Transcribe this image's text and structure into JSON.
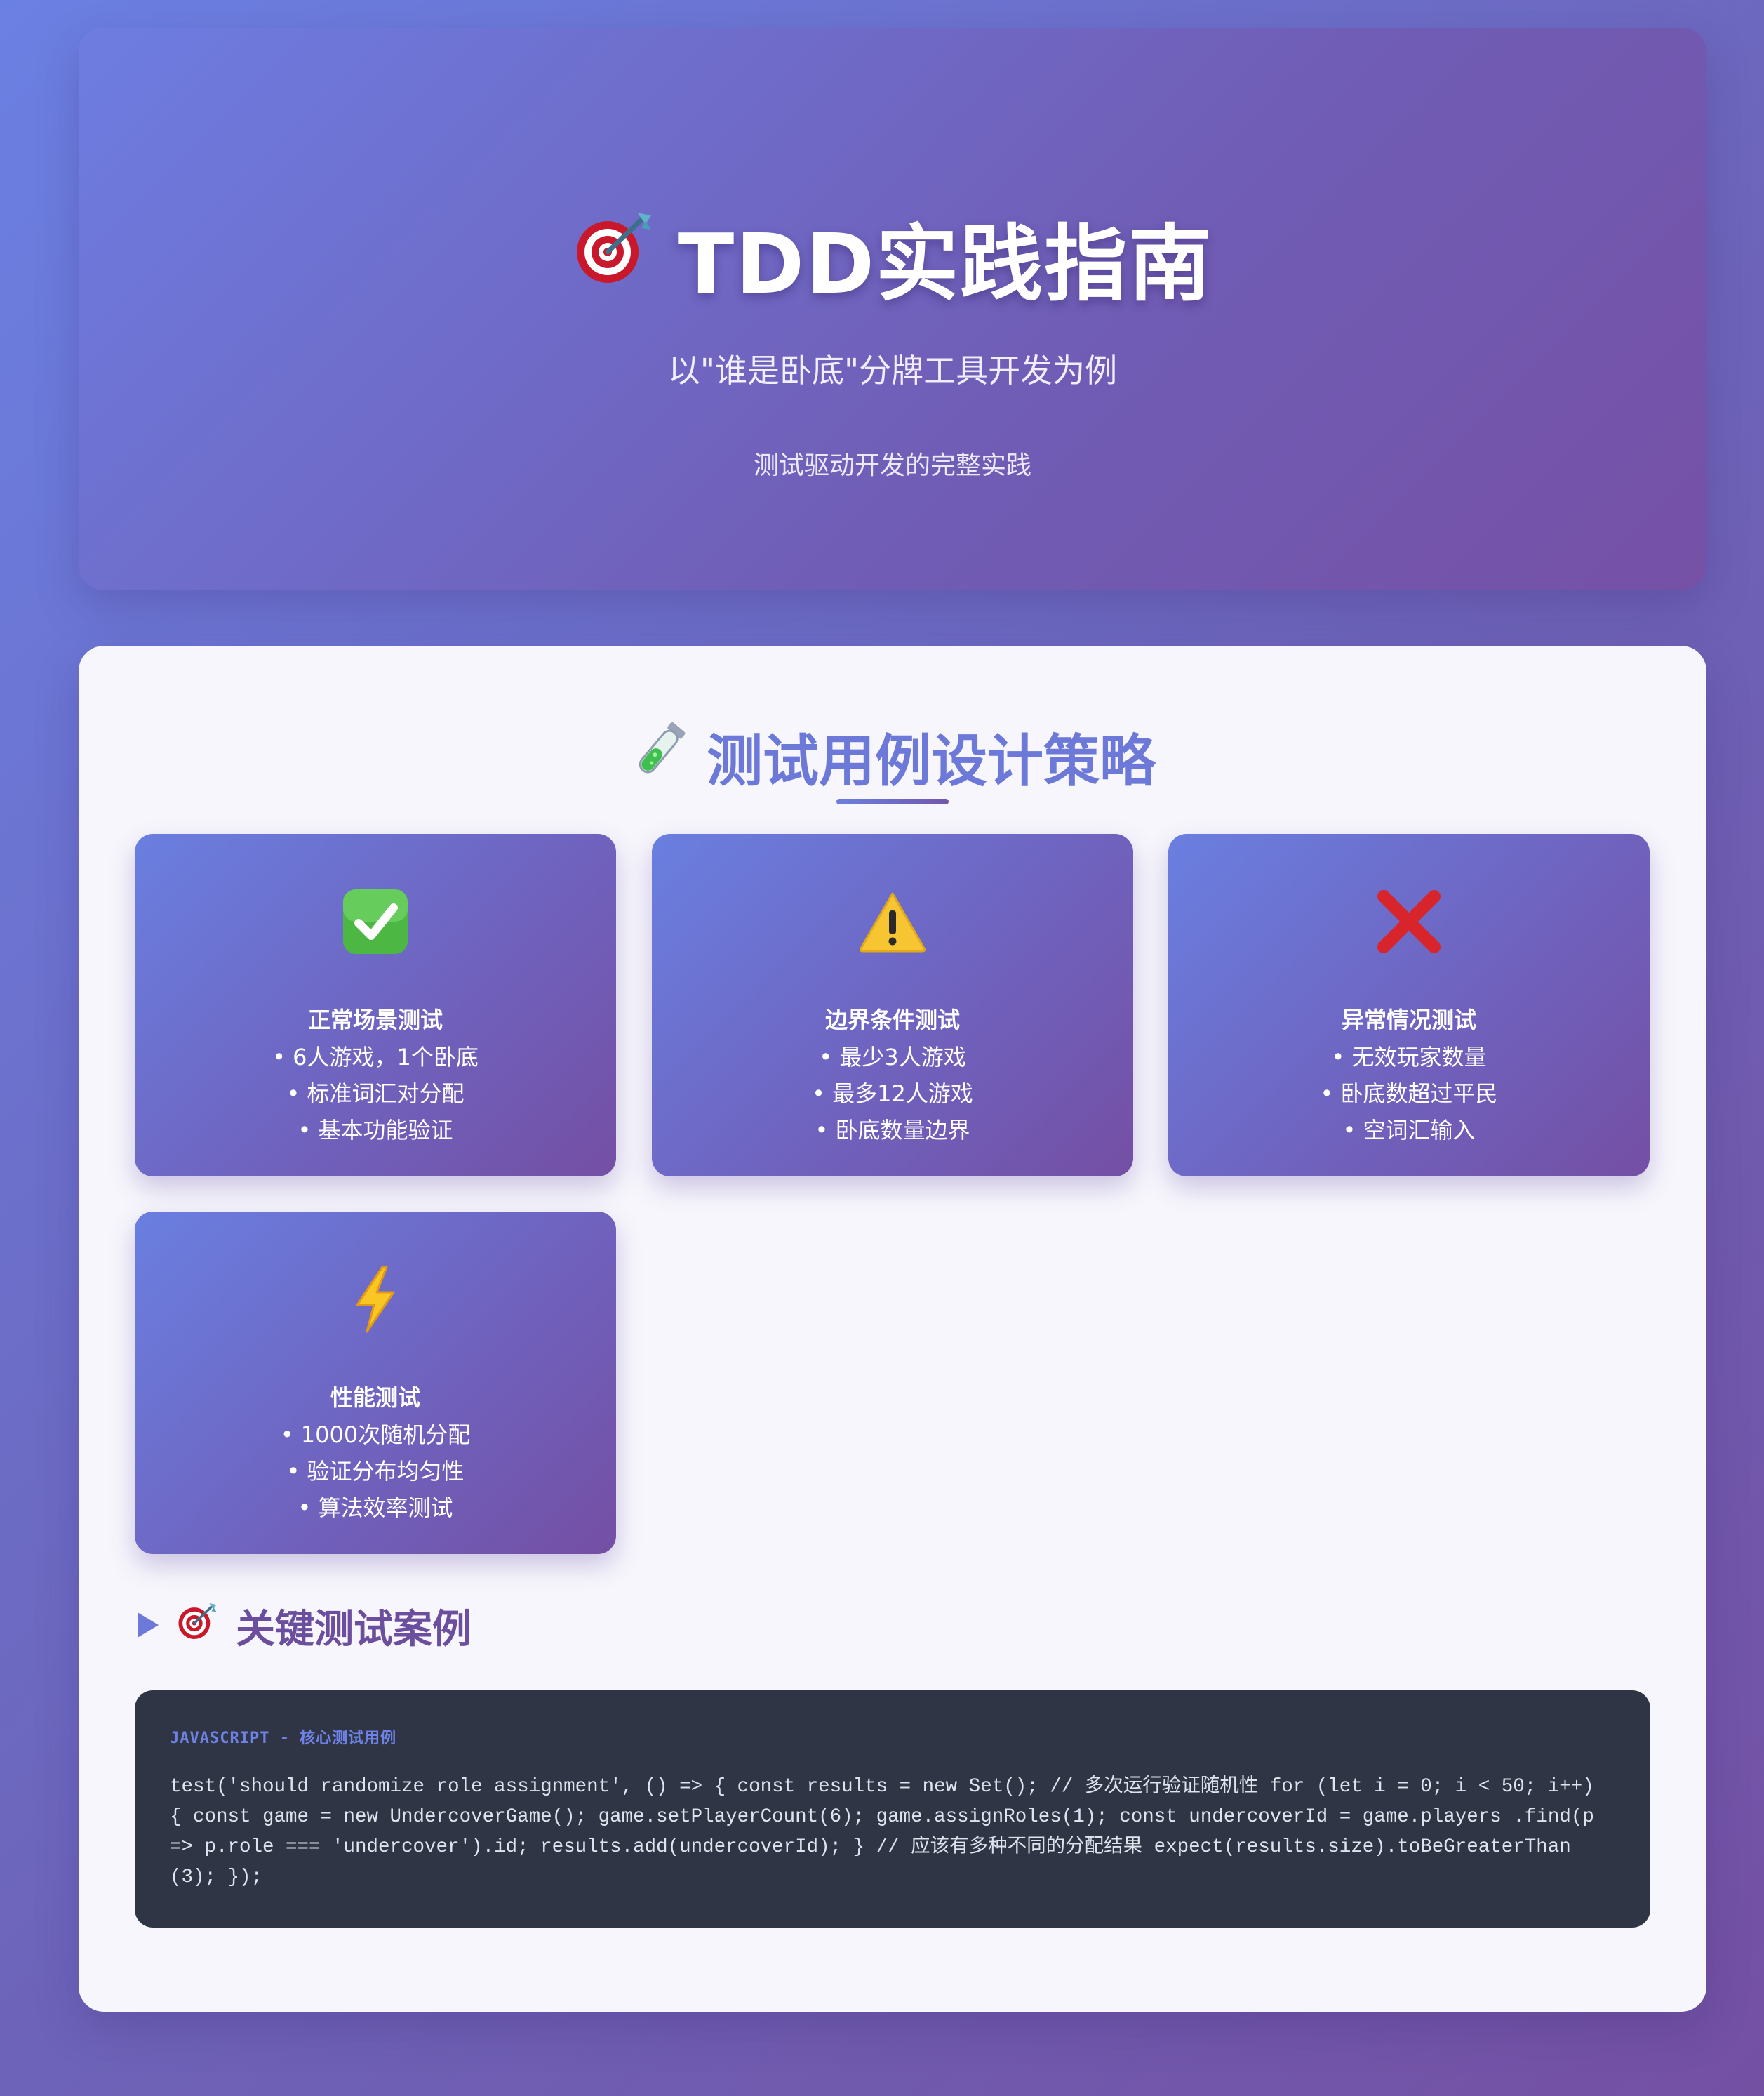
{
  "hero": {
    "title": "TDD实践指南",
    "title_icon": "dart-target-icon",
    "subtitle": "以\"谁是卧底\"分牌工具开发为例",
    "description": "测试驱动开发的完整实践"
  },
  "strategy": {
    "title": "测试用例设计策略",
    "title_icon": "test-tube-icon",
    "cards": [
      {
        "icon": "check-mark-icon",
        "title": "正常场景测试",
        "items": [
          "• 6人游戏，1个卧底",
          "• 标准词汇对分配",
          "• 基本功能验证"
        ]
      },
      {
        "icon": "warning-icon",
        "title": "边界条件测试",
        "items": [
          "• 最少3人游戏",
          "• 最多12人游戏",
          "• 卧底数量边界"
        ]
      },
      {
        "icon": "cross-mark-icon",
        "title": "异常情况测试",
        "items": [
          "• 无效玩家数量",
          "• 卧底数超过平民",
          "• 空词汇输入"
        ]
      },
      {
        "icon": "lightning-icon",
        "title": "性能测试",
        "items": [
          "• 1000次随机分配",
          "• 验证分布均匀性",
          "• 算法效率测试"
        ]
      }
    ]
  },
  "cases": {
    "title": "关键测试案例",
    "toggle_icon": "triangle-right-icon",
    "title_icon": "dart-target-icon",
    "code_label": "JAVASCRIPT - 核心测试用例",
    "code": "test('should randomize role assignment', () => { const results = new Set(); // 多次运行验证随机性 for (let i = 0; i < 50; i++) { const game = new UndercoverGame(); game.setPlayerCount(6); game.assignRoles(1); const undercoverId = game.players .find(p => p.role === 'undercover').id; results.add(undercoverId); } // 应该有多种不同的分配结果 expect(results.size).toBeGreaterThan(3); });"
  },
  "colors": {
    "accent_blue": "#6c79d8",
    "accent_purple": "#6b4f9e",
    "code_background": "#2f3544"
  }
}
